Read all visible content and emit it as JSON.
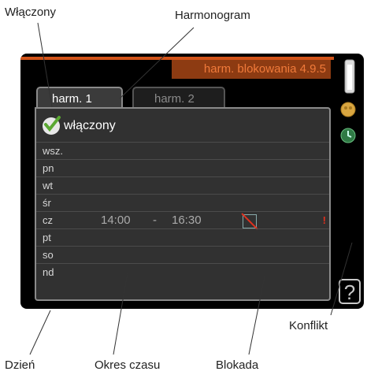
{
  "callouts": {
    "enabled": "Włączony",
    "schedule": "Harmonogram",
    "conflict": "Konflikt",
    "day": "Dzień",
    "period": "Okres czasu",
    "block": "Blokada"
  },
  "header": {
    "title": "harm. blokowania  4.9.5"
  },
  "tabs": [
    {
      "label": "harm. 1",
      "active": true
    },
    {
      "label": "harm. 2",
      "active": false
    }
  ],
  "enabled_label": "włączony",
  "rows": [
    {
      "day": "wsz."
    },
    {
      "day": "pn"
    },
    {
      "day": "wt"
    },
    {
      "day": "śr"
    },
    {
      "day": "cz",
      "start": "14:00",
      "sep": "-",
      "end": "16:30",
      "blocked": true,
      "conflict": "!"
    },
    {
      "day": "pt"
    },
    {
      "day": "so"
    },
    {
      "day": "nd"
    }
  ],
  "help": "?",
  "colors": {
    "accent": "#d2541a",
    "title_bg": "#8d3b12",
    "conflict": "#e0301e"
  }
}
